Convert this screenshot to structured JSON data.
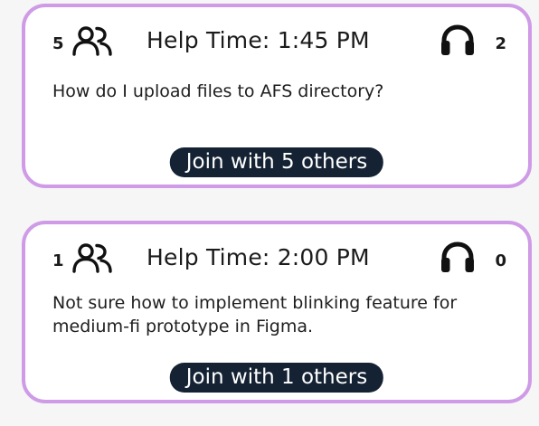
{
  "colors": {
    "card_border": "#cf9be6",
    "button_bg": "#142233",
    "button_text": "#ffffff",
    "background": "#f6f6f6"
  },
  "icons": {
    "participants": "people-icon",
    "helpers": "headset-icon"
  },
  "cards": [
    {
      "participant_count": "5",
      "help_time": "Help Time: 1:45 PM",
      "helper_count": "2",
      "question": "How do I upload files to AFS directory?",
      "join_label": "Join with 5 others"
    },
    {
      "participant_count": "1",
      "help_time": "Help Time: 2:00 PM",
      "helper_count": "0",
      "question": "Not sure how to implement blinking feature for medium-fi prototype in Figma.",
      "join_label": "Join with 1 others"
    }
  ]
}
